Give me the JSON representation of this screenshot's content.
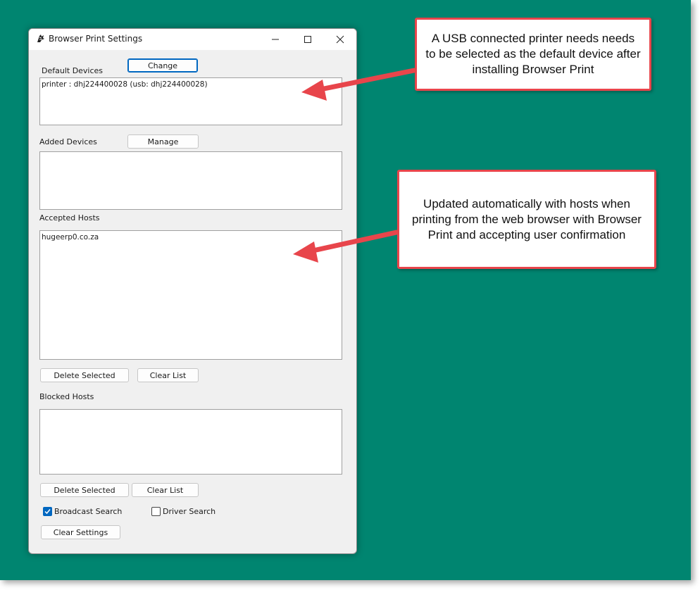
{
  "window": {
    "title": "Browser Print Settings",
    "icon": "zebra-head-icon"
  },
  "default_devices": {
    "label": "Default Devices",
    "change_button": "Change",
    "items": [
      "printer : dhj224400028 (usb: dhj224400028)"
    ]
  },
  "added_devices": {
    "label": "Added Devices",
    "manage_button": "Manage",
    "items": []
  },
  "accepted_hosts": {
    "label": "Accepted Hosts",
    "items": [
      "hugeerp0.co.za"
    ],
    "delete_button": "Delete Selected",
    "clear_button": "Clear List"
  },
  "blocked_hosts": {
    "label": "Blocked Hosts",
    "items": [],
    "delete_button": "Delete Selected",
    "clear_button": "Clear List"
  },
  "options": {
    "broadcast_search": {
      "label": "Broadcast Search",
      "checked": true
    },
    "driver_search": {
      "label": "Driver Search",
      "checked": false
    },
    "clear_settings_button": "Clear Settings"
  },
  "callouts": {
    "usb_printer": "A USB connected printer needs needs to be selected as the default device after installing Browser Print",
    "hosts_updated": "Updated automatically with hosts when printing from the web browser with Browser Print and accepting user confirmation"
  },
  "colors": {
    "desktop": "#008570",
    "accent": "#0067c0",
    "callout_border": "#e8454b"
  }
}
